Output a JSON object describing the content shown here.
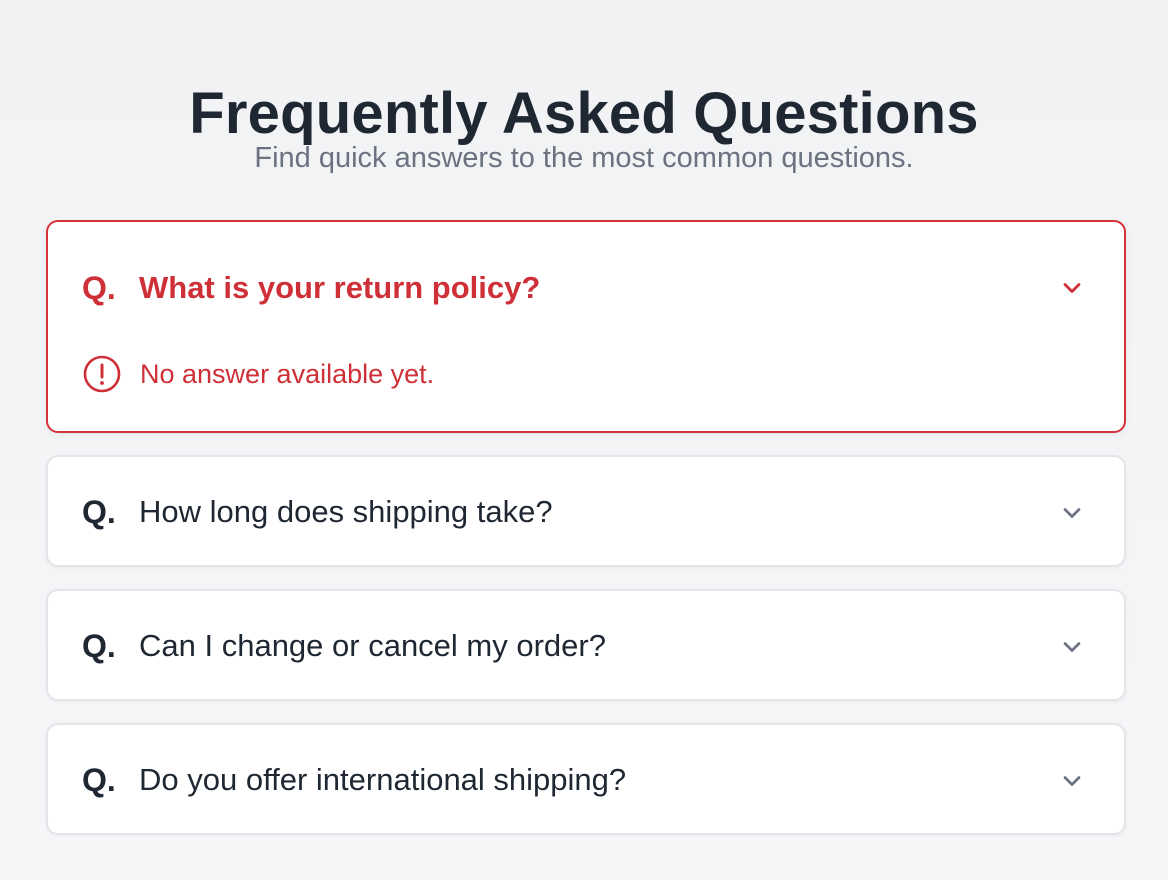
{
  "page": {
    "title": "Frequently Asked Questions",
    "subtitle": "Find quick answers to the most common questions."
  },
  "faq": {
    "question_prefix": "Q.",
    "items": [
      {
        "question": "What is your return policy?",
        "state": "error",
        "expanded": true,
        "status_message": "No answer available yet."
      },
      {
        "question": "How long does shipping take?",
        "state": "default",
        "expanded": false
      },
      {
        "question": "Can I change or cancel my order?",
        "state": "default",
        "expanded": false
      },
      {
        "question": "Do you offer international shipping?",
        "state": "default",
        "expanded": false
      }
    ]
  },
  "icons": {
    "chevron": "chevron-down-icon",
    "alert": "alert-circle-icon"
  },
  "colors": {
    "error_accent": "#cf2f37",
    "card_border": "#e3e5e8",
    "title_text": "#1f2733",
    "muted_text": "#6b7280"
  }
}
